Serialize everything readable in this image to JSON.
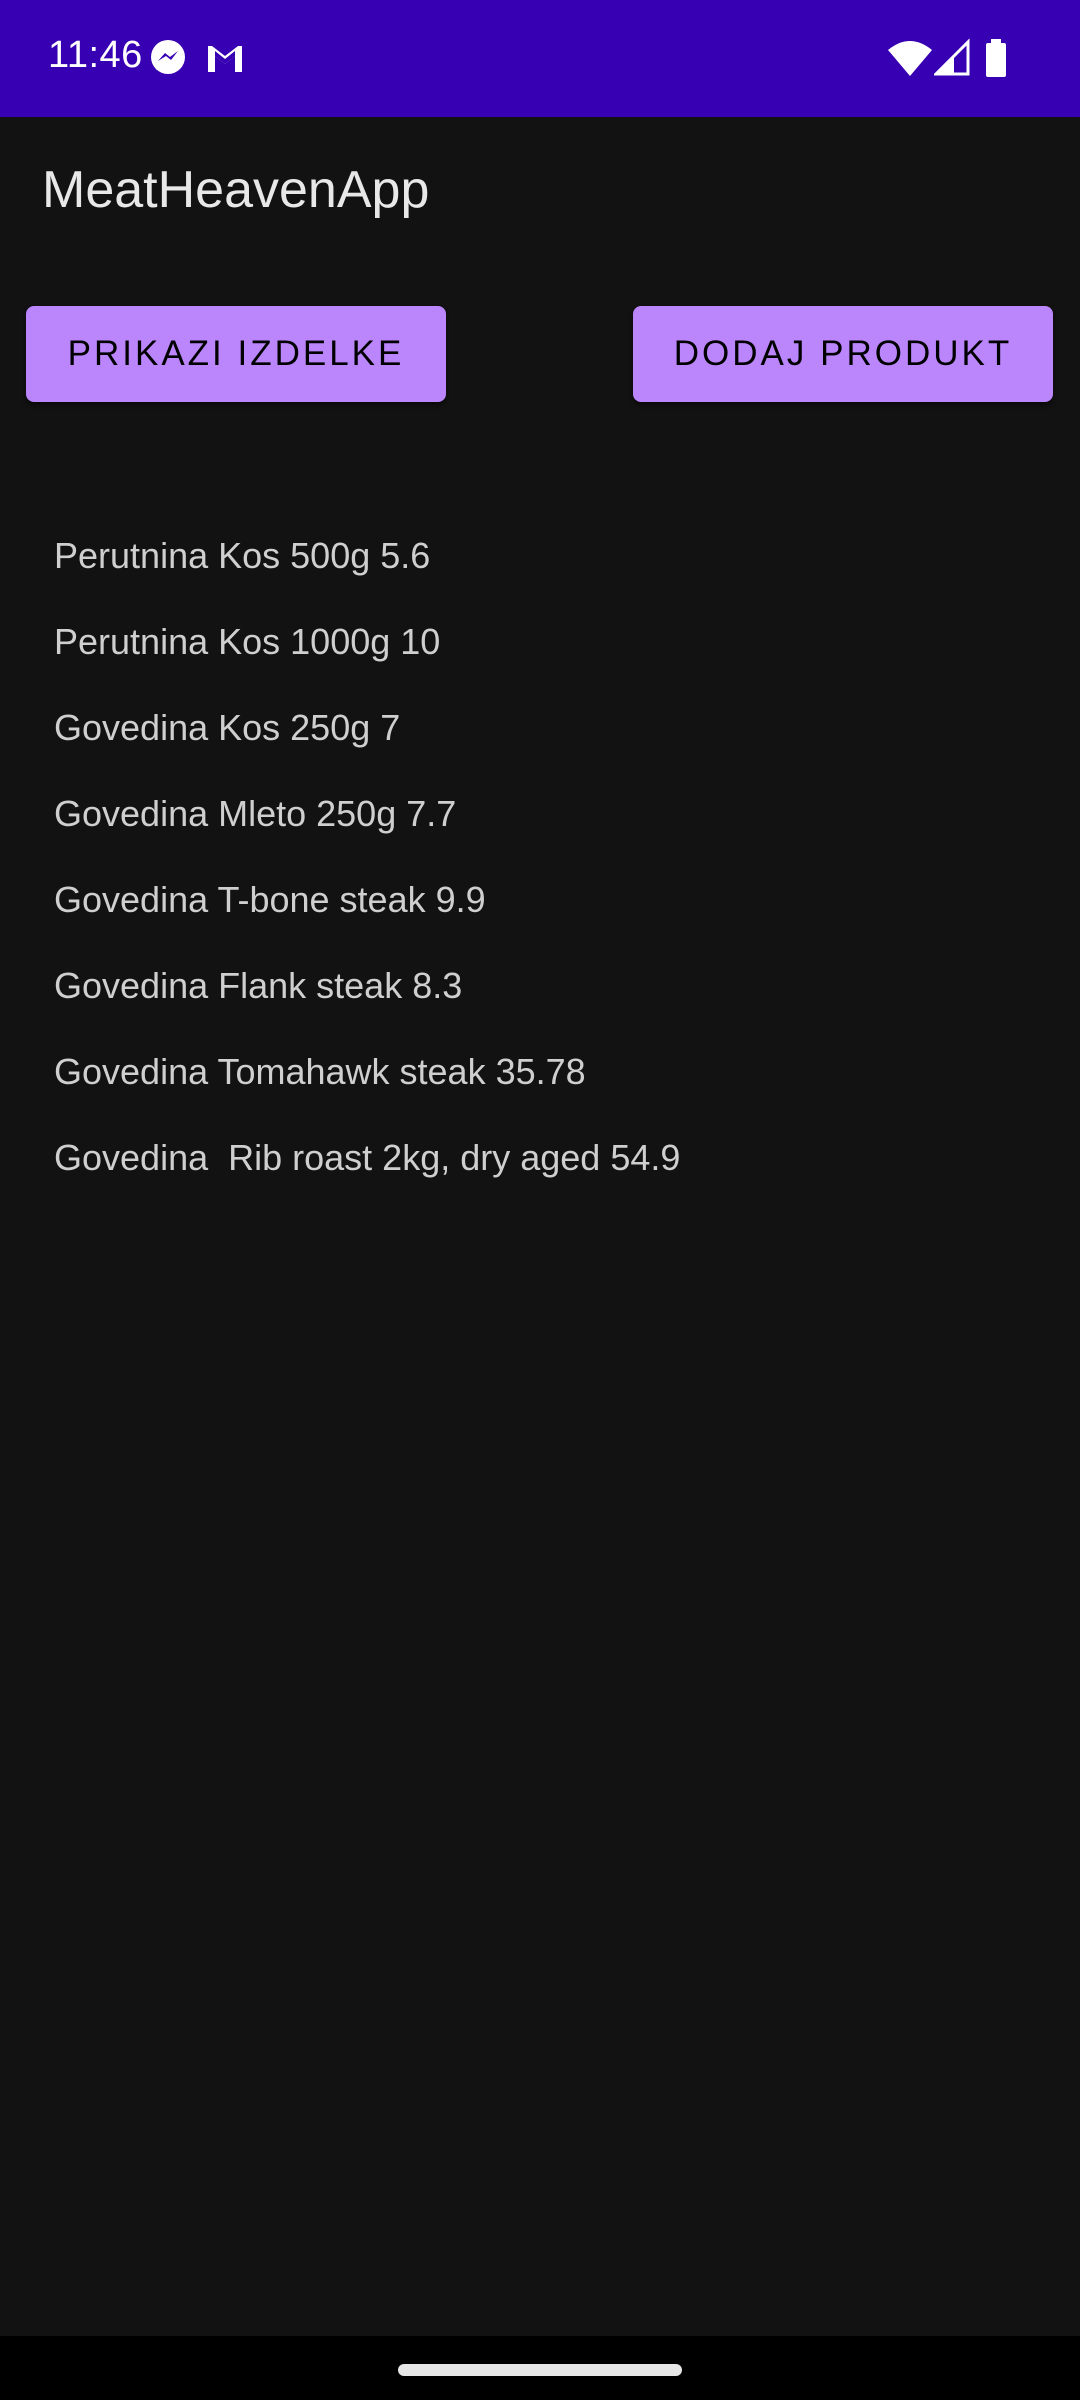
{
  "status_bar": {
    "time": "11:46",
    "background_color": "#3700B3",
    "left_icons": [
      "messenger-icon",
      "gmail-icon"
    ],
    "right_icons": [
      "wifi-icon",
      "signal-icon",
      "battery-icon"
    ]
  },
  "app_bar": {
    "title": "MeatHeavenApp"
  },
  "buttons": {
    "show_products_label": "PRIKAZI IZDELKE",
    "add_product_label": "DODAJ PRODUKT",
    "color": "#BB86FC"
  },
  "products": [
    "Perutnina Kos 500g 5.6",
    "Perutnina Kos 1000g 10",
    "Govedina Kos 250g 7",
    "Govedina Mleto 250g 7.7",
    "Govedina T-bone steak 9.9",
    "Govedina Flank steak 8.3",
    "Govedina Tomahawk steak 35.78",
    "Govedina  Rib roast 2kg, dry aged 54.9"
  ]
}
